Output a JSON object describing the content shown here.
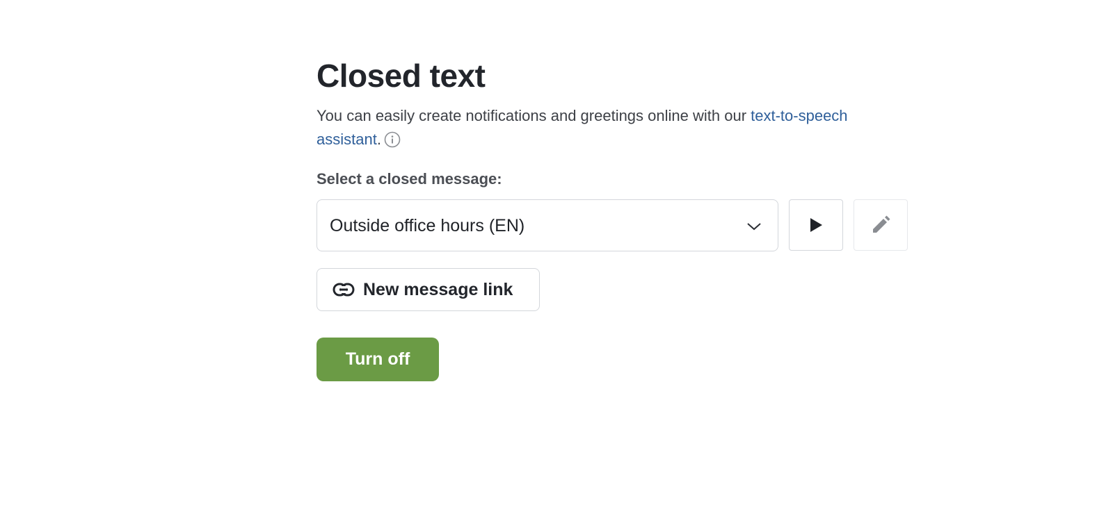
{
  "header": {
    "title": "Closed text"
  },
  "description": {
    "text_before_link": "You can easily create notifications and greetings online with our ",
    "link_text": "text-to-speech assistant",
    "text_after_link": "."
  },
  "closed_message": {
    "label": "Select a closed message:",
    "selected_value": "Outside office hours (EN)"
  },
  "actions": {
    "new_message_link_label": "New message link",
    "turn_off_label": "Turn off"
  },
  "icons": {
    "info": "info-icon",
    "dropdown": "chevron-down-icon",
    "play": "play-icon",
    "edit": "pencil-icon",
    "link": "link-icon"
  },
  "colors": {
    "primary_button": "#6b9b45",
    "link": "#2f5f9a",
    "disabled_icon": "#8a8d92"
  }
}
